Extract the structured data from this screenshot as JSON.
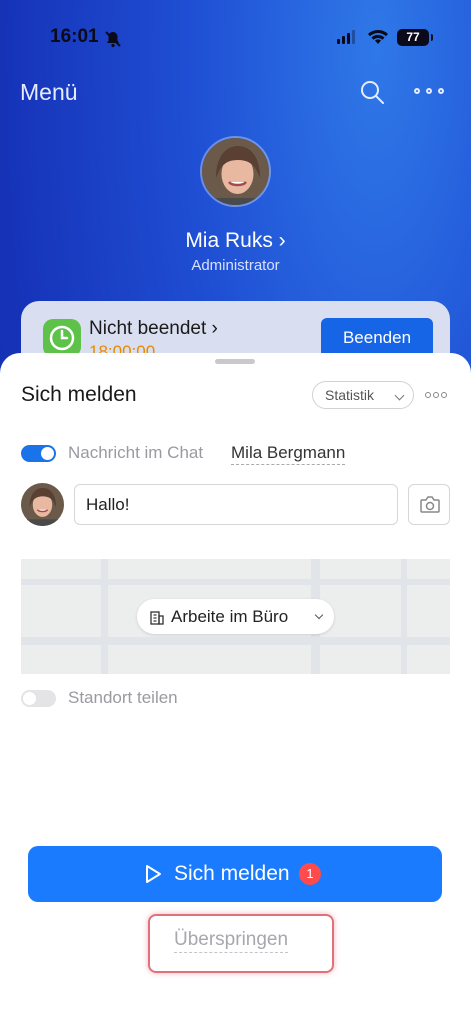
{
  "status_bar": {
    "time": "16:01",
    "battery": "77"
  },
  "header": {
    "menu_label": "Menü"
  },
  "profile": {
    "name": "Mia Ruks ›",
    "role": "Administrator"
  },
  "workday": {
    "status": "Nicht beendet ›",
    "time": "18:00:00",
    "end_label": "Beenden"
  },
  "sheet": {
    "title": "Sich melden",
    "stats_label": "Statistik",
    "chat_label": "Nachricht im Chat",
    "chat_recipient": "Mila Bergmann",
    "message_value": "Hallo!",
    "location_label": "Arbeite im Büro",
    "share_location_label": "Standort teilen",
    "checkin_label": "Sich melden",
    "checkin_badge": "1",
    "skip_label": "Überspringen"
  },
  "colors": {
    "accent": "#1a7bff",
    "badge": "#ff4b4b",
    "highlight": "#e0707a",
    "timer": "#e88a00"
  }
}
